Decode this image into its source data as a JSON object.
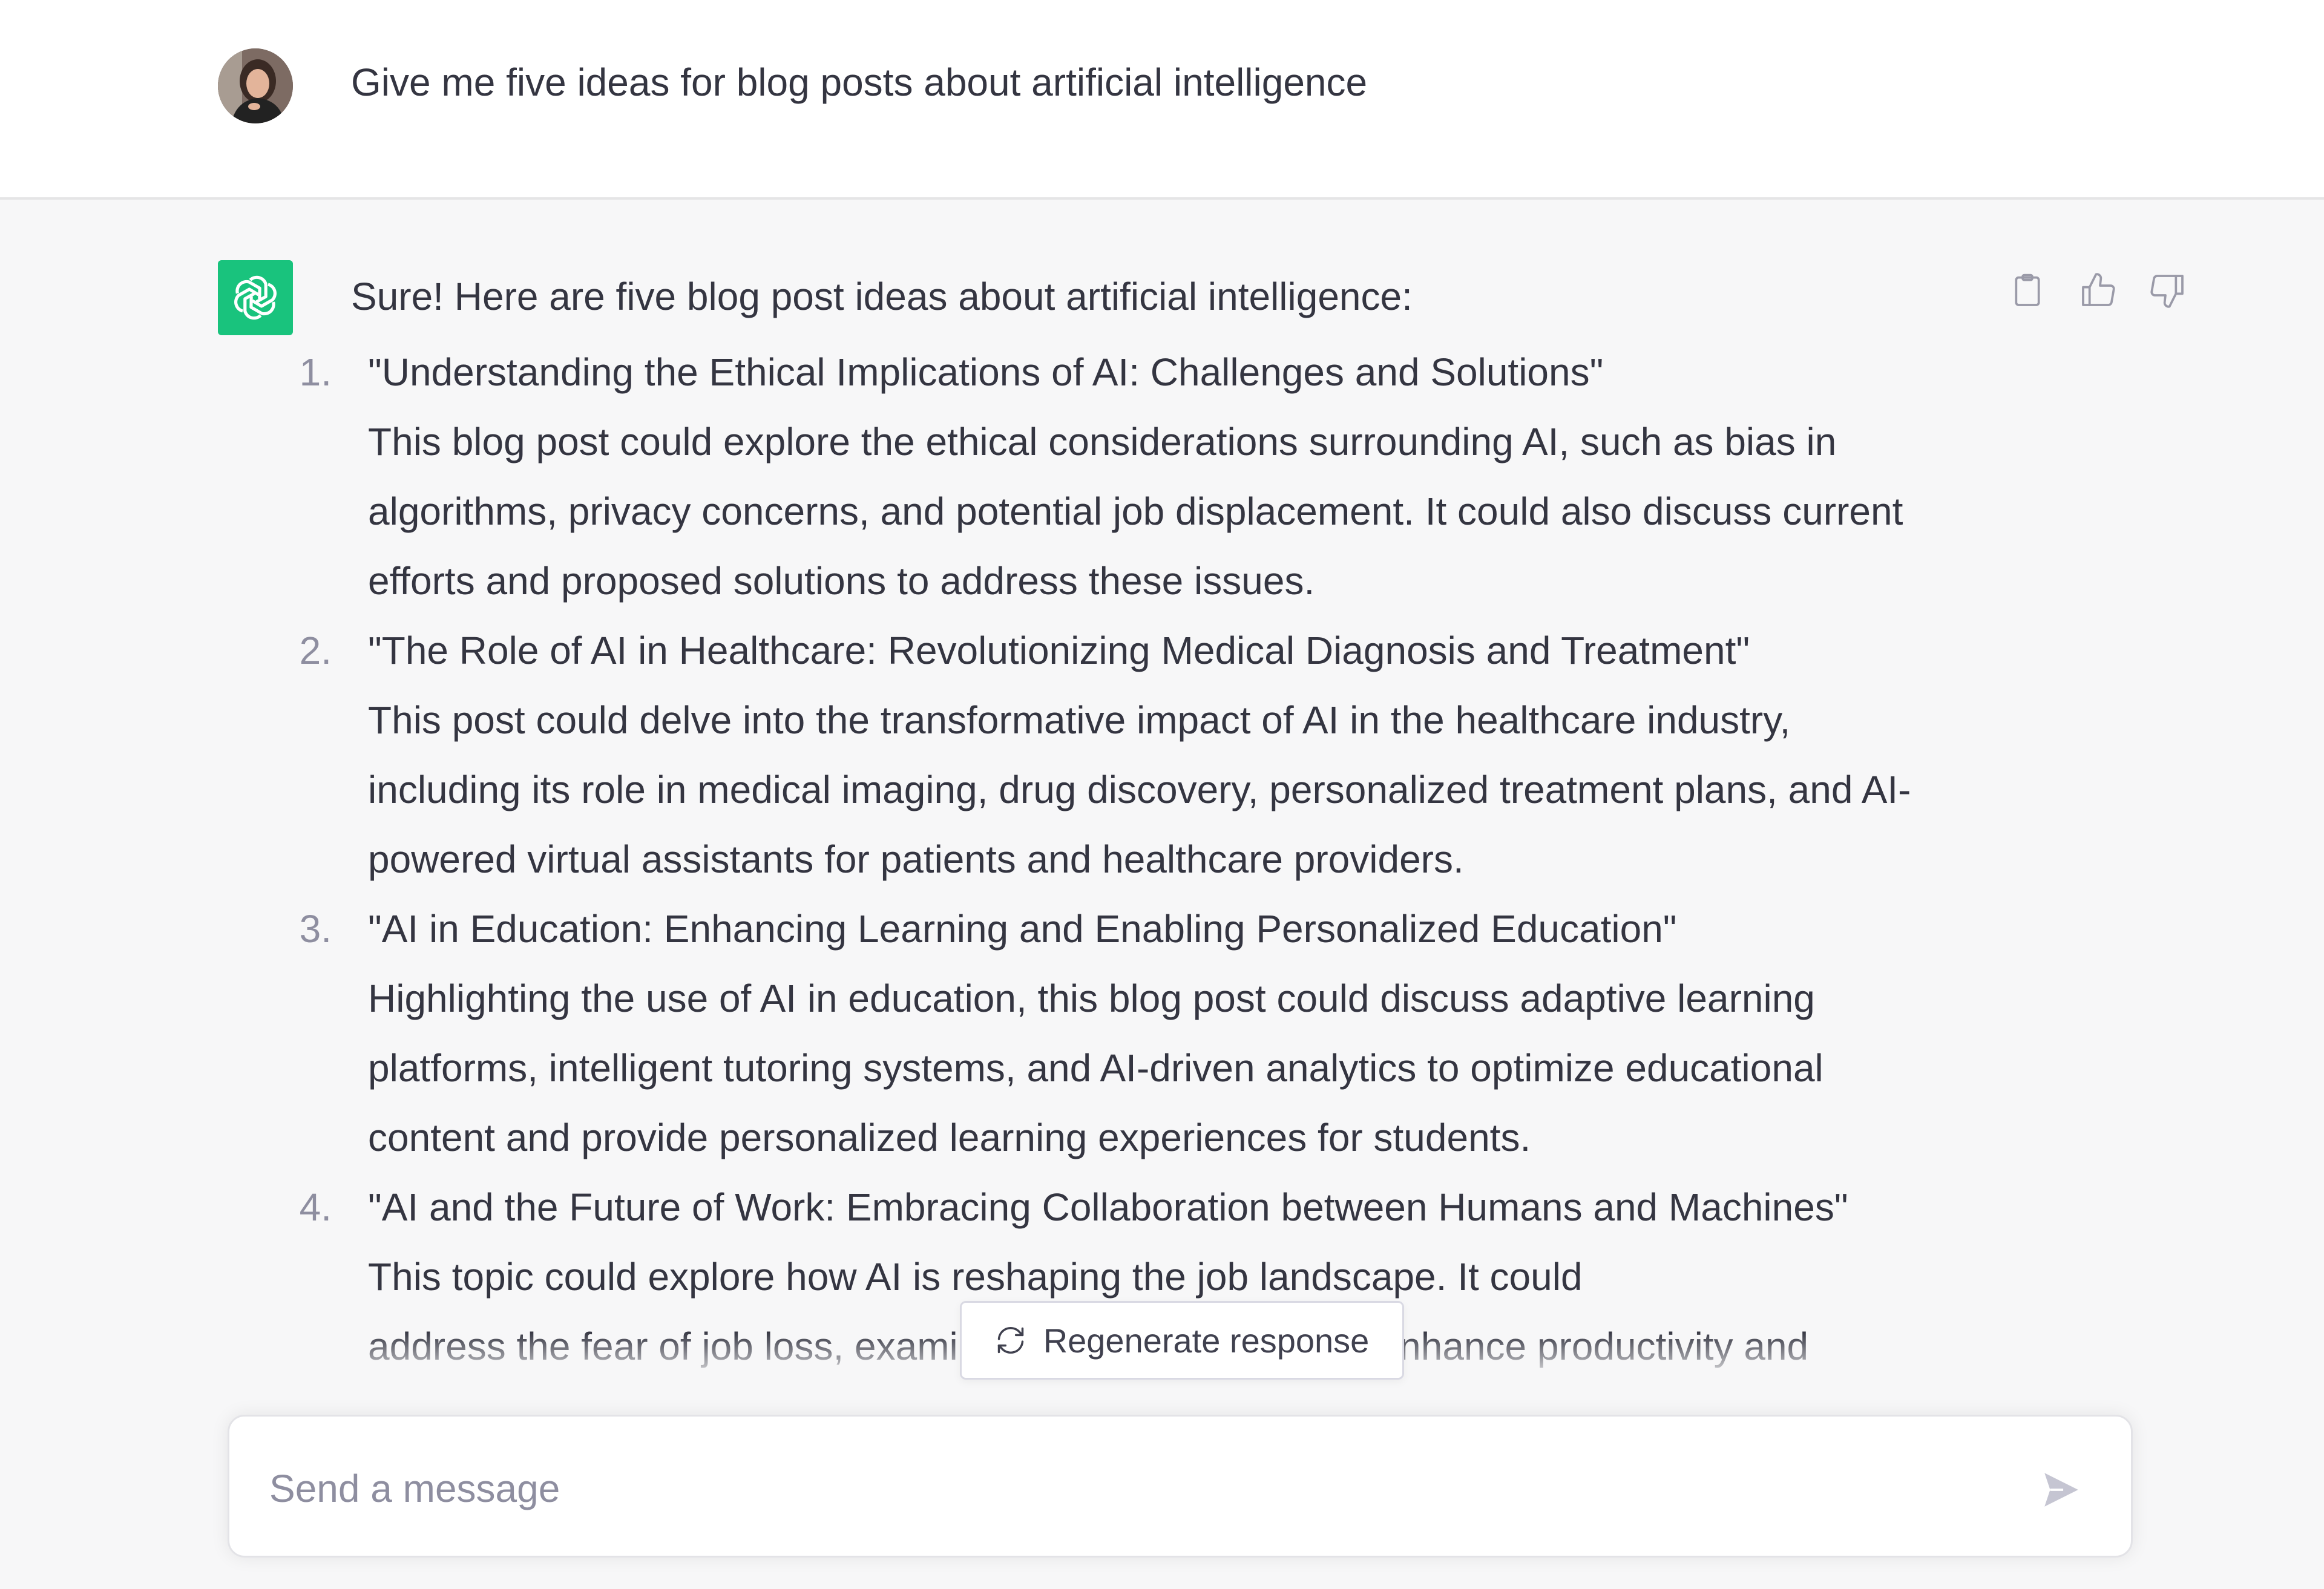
{
  "user_message": {
    "text": "Give me five ideas for blog posts about artificial intelligence"
  },
  "assistant_message": {
    "intro": "Sure! Here are five blog post ideas about artificial intelligence:",
    "ideas": [
      {
        "number": "1.",
        "title": "\"Understanding the Ethical Implications of AI: Challenges and Solutions\"",
        "lines": [
          "This blog post could explore the ethical considerations surrounding AI, such as bias in",
          "algorithms, privacy concerns, and potential job displacement. It could also discuss current",
          "efforts and proposed solutions to address these issues."
        ]
      },
      {
        "number": "2.",
        "title": "\"The Role of AI in Healthcare: Revolutionizing Medical Diagnosis and Treatment\"",
        "lines": [
          "This post could delve into the transformative impact of AI in the healthcare industry,",
          "including its role in medical imaging, drug discovery, personalized treatment plans, and AI-",
          "powered virtual assistants for patients and healthcare providers."
        ]
      },
      {
        "number": "3.",
        "title": "\"AI in Education: Enhancing Learning and Enabling Personalized Education\"",
        "lines": [
          "Highlighting the use of AI in education, this blog post could discuss adaptive learning",
          "platforms, intelligent tutoring systems, and AI-driven analytics to optimize educational",
          "content and provide personalized learning experiences for students."
        ]
      },
      {
        "number": "4.",
        "title": "\"AI and the Future of Work: Embracing Collaboration between Humans and Machines\"",
        "lines": [
          "This topic could explore how AI is reshaping the job landscape. It could",
          "address the fear of job loss, examine the potential for AI to enhance productivity and"
        ]
      }
    ]
  },
  "actions": {
    "copy_icon": "clipboard-icon",
    "like_icon": "thumbs-up-icon",
    "dislike_icon": "thumbs-down-icon"
  },
  "regenerate": {
    "label": "Regenerate response",
    "icon": "refresh-icon"
  },
  "composer": {
    "placeholder": "Send a message",
    "send_icon": "send-icon"
  },
  "colors": {
    "brand_green": "#19c37d",
    "text": "#343541",
    "muted": "#8e8ea0",
    "assistant_bg": "#f7f7f8",
    "user_bg": "#ffffff"
  }
}
